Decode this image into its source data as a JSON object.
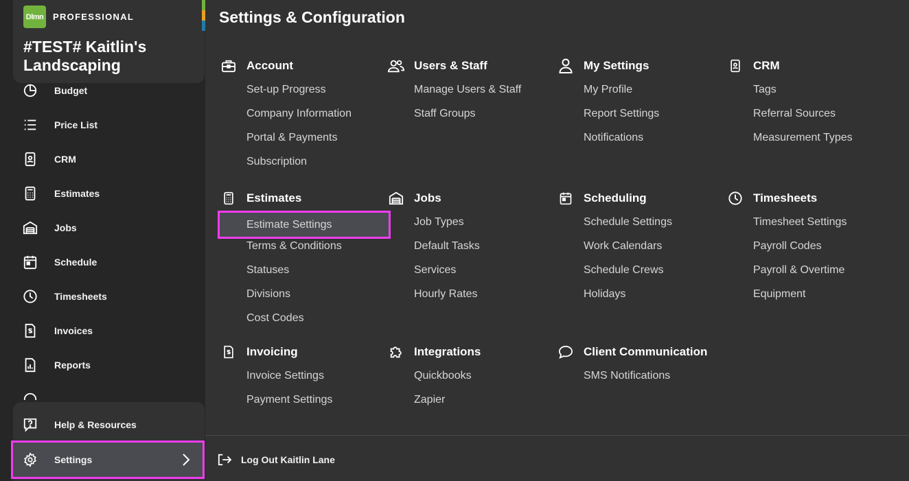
{
  "brand": {
    "logo_text": "Dlmn",
    "tier": "PROFESSIONAL",
    "company": "#TEST# Kaitlin's Landscaping",
    "strip_colors": [
      "#72b33e",
      "#e8a020",
      "#1f7aa8"
    ]
  },
  "sidebar": {
    "items": [
      {
        "label": "Budget",
        "icon": "budget-icon"
      },
      {
        "label": "Price List",
        "icon": "list-icon"
      },
      {
        "label": "CRM",
        "icon": "contact-card-icon"
      },
      {
        "label": "Estimates",
        "icon": "calculator-icon"
      },
      {
        "label": "Jobs",
        "icon": "garage-icon"
      },
      {
        "label": "Schedule",
        "icon": "calendar-icon"
      },
      {
        "label": "Timesheets",
        "icon": "clock-icon"
      },
      {
        "label": "Invoices",
        "icon": "invoice-icon"
      },
      {
        "label": "Reports",
        "icon": "report-icon"
      }
    ],
    "help": {
      "label": "Help & Resources",
      "icon": "help-icon"
    },
    "settings": {
      "label": "Settings",
      "icon": "gear-icon"
    }
  },
  "main": {
    "title": "Settings & Configuration",
    "sections": [
      {
        "title": "Account",
        "icon": "briefcase-icon",
        "links": [
          "Set-up Progress",
          "Company Information",
          "Portal & Payments",
          "Subscription"
        ]
      },
      {
        "title": "Users & Staff",
        "icon": "users-icon",
        "links": [
          "Manage Users & Staff",
          "Staff Groups"
        ]
      },
      {
        "title": "My Settings",
        "icon": "user-icon",
        "links": [
          "My Profile",
          "Report Settings",
          "Notifications"
        ]
      },
      {
        "title": "CRM",
        "icon": "contact-card-icon",
        "links": [
          "Tags",
          "Referral Sources",
          "Measurement Types"
        ]
      },
      {
        "title": "Estimates",
        "icon": "calculator-icon",
        "links": [
          "Estimate Settings",
          "Terms & Conditions",
          "Statuses",
          "Divisions",
          "Cost Codes"
        ]
      },
      {
        "title": "Jobs",
        "icon": "garage-icon",
        "links": [
          "Job Types",
          "Default Tasks",
          "Services",
          "Hourly Rates"
        ]
      },
      {
        "title": "Scheduling",
        "icon": "calendar-icon",
        "links": [
          "Schedule Settings",
          "Work Calendars",
          "Schedule Crews",
          "Holidays"
        ]
      },
      {
        "title": "Timesheets",
        "icon": "clock-icon",
        "links": [
          "Timesheet Settings",
          "Payroll Codes",
          "Payroll & Overtime",
          "Equipment"
        ]
      },
      {
        "title": "Invoicing",
        "icon": "invoice-icon",
        "links": [
          "Invoice Settings",
          "Payment Settings"
        ]
      },
      {
        "title": "Integrations",
        "icon": "puzzle-icon",
        "links": [
          "Quickbooks",
          "Zapier"
        ]
      },
      {
        "title": "Client Communication",
        "icon": "chat-bubble-icon",
        "links": [
          "SMS Notifications"
        ]
      }
    ],
    "logout": {
      "label": "Log Out Kaitlin Lane",
      "icon": "logout-icon"
    }
  },
  "colors": {
    "highlight_border": "#f03cf0",
    "selected_bg": "#4a4b50",
    "sidebar_bg": "#262626",
    "main_bg": "#323232"
  }
}
